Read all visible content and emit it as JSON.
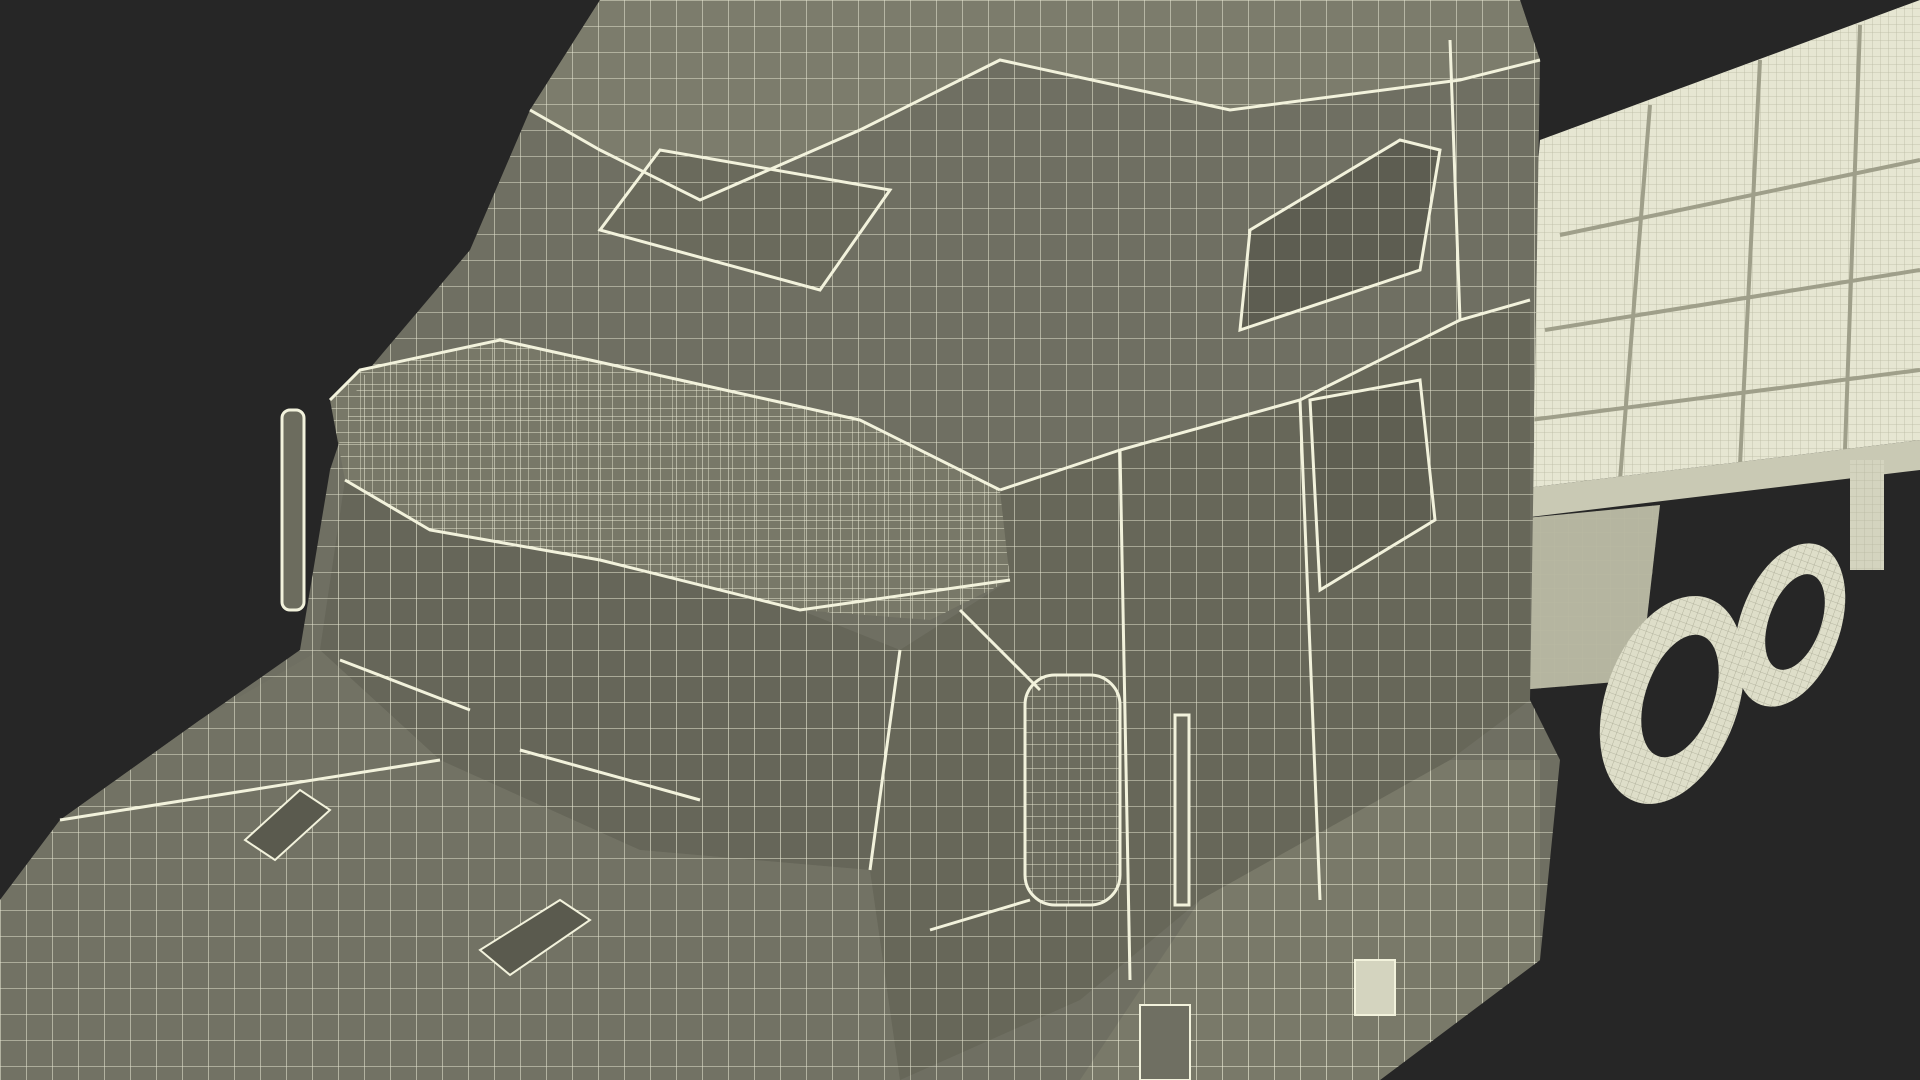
{
  "scene": {
    "subject": "semi-truck-cab-with-flatbed-trailer-wireframe",
    "background_color": "#262626",
    "cab_body_color": "#6f6f62",
    "cab_shadow_color": "#5d5d52",
    "cab_light_color": "#858574",
    "trailer_color": "#e6e6d2",
    "trailer_shadow_color": "#c9c9b4",
    "wire_color": "#f2f2dc",
    "trailer_wire_color": "#b9b9a2"
  }
}
